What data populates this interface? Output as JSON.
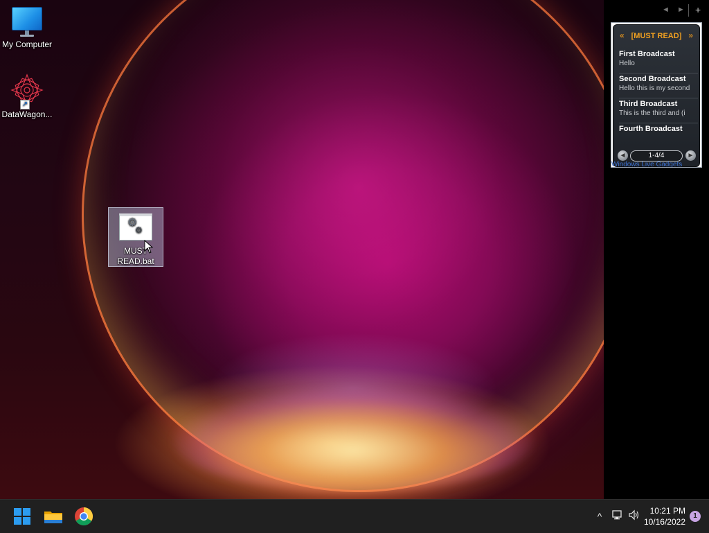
{
  "desktop": {
    "icons": [
      {
        "label": "My Computer",
        "icon": "monitor-icon"
      },
      {
        "label": "DataWagon...",
        "icon": "datawagon-logo-icon"
      },
      {
        "label": "MUST READ.bat",
        "label_line1": "MUST",
        "label_line2": "READ.bat",
        "icon": "batch-file-icon",
        "selected": true
      }
    ]
  },
  "gadget": {
    "title": "[MUST READ]",
    "prev_symbol": "«",
    "next_symbol": "»",
    "items": [
      {
        "title": "First Broadcast",
        "subtitle": "Hello"
      },
      {
        "title": "Second Broadcast",
        "subtitle": "Hello this is my second"
      },
      {
        "title": "Third Broadcast",
        "subtitle": "This is the third and (i"
      },
      {
        "title": "Fourth Broadcast",
        "subtitle": ""
      }
    ],
    "pager": "1-4/4",
    "caption": "Windows Live Gadgets",
    "controls": {
      "back": "◄",
      "forward": "►",
      "add": "+"
    }
  },
  "taskbar": {
    "apps": [
      "start-icon",
      "file-explorer-icon",
      "chrome-icon"
    ],
    "tray": {
      "overflow": "^",
      "time": "10:21 PM",
      "date": "10/16/2022",
      "notification_count": "1"
    }
  },
  "colors": {
    "gadget_title": "#f0a020",
    "taskbar": "#202020",
    "windows_blue": "#2c9cf0",
    "notification_badge": "#c7a4e3"
  }
}
